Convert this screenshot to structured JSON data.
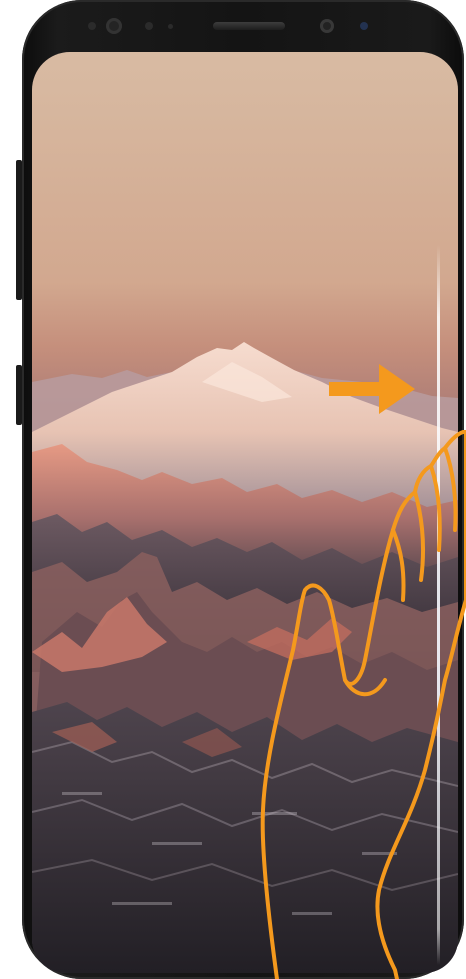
{
  "device": {
    "model": "smartphone",
    "body_color": "#141414",
    "screen": {
      "wallpaper": "mountain-range-at-sunset",
      "sky_top_color": "#d7b8a1",
      "sky_mid_color": "#c9957d",
      "sky_bottom_color": "#9a6b67",
      "peak_highlight_color": "#f2c8b6",
      "mountain_shadow_color": "#3f3843"
    }
  },
  "gesture_hint": {
    "type": "edge-swipe",
    "direction": "right",
    "accent_color": "#f4991d",
    "arrow_icon": "right-arrow-icon",
    "hand_icon": "hand-outline-icon"
  }
}
